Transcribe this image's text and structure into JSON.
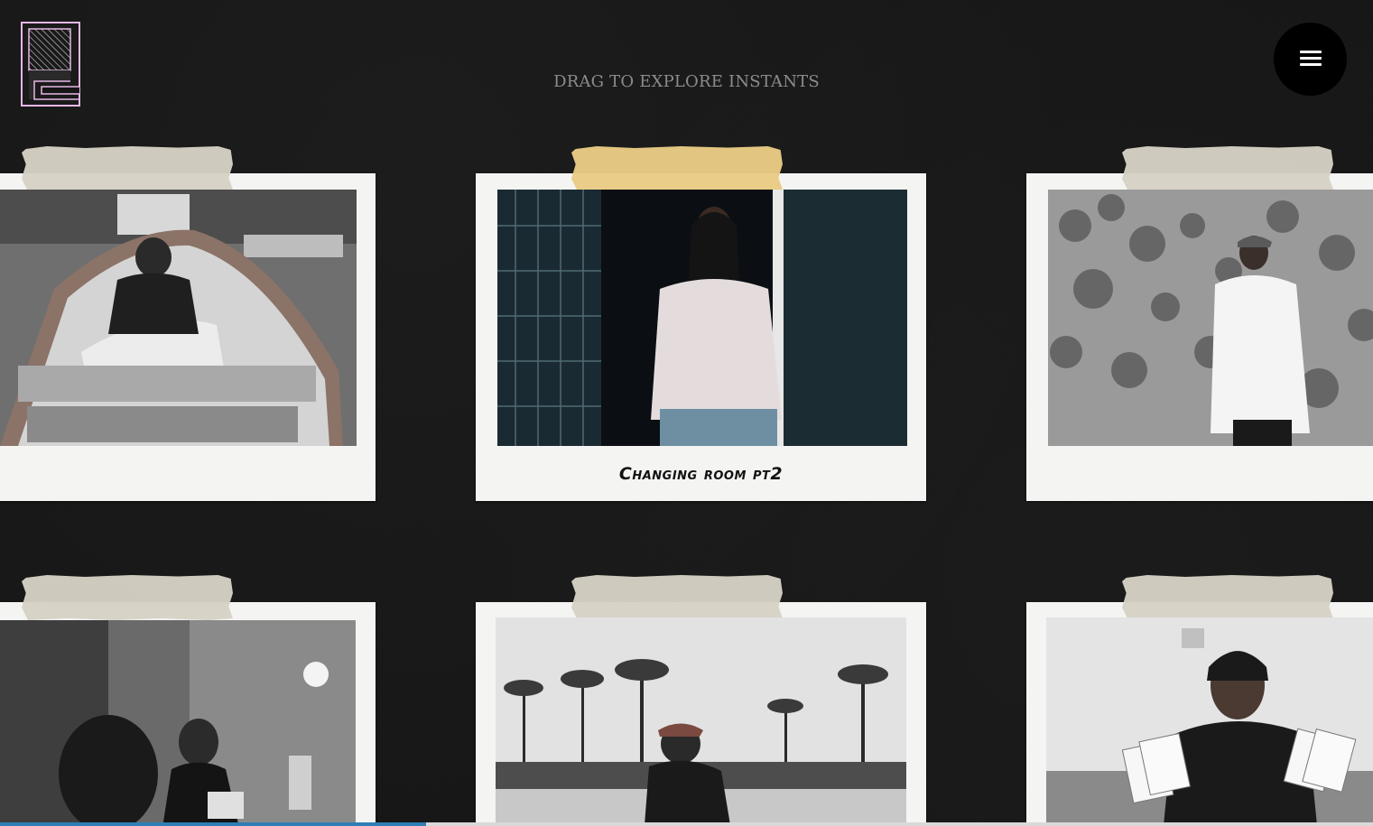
{
  "header": {
    "logo_icon": "pe-monogram-logo",
    "hint": "DRAG TO EXPLORE INSTANTS",
    "menu_icon": "hamburger-menu-icon"
  },
  "colors": {
    "background": "#161616",
    "polaroid_frame": "#f4f4f3",
    "tape": "#d6d1c5",
    "tape_highlight": "#e8cb84",
    "logo_stroke": "#e8b7e6",
    "menu_button": "#000000",
    "progress": "#2f7fb6"
  },
  "instants": [
    {
      "caption": "",
      "scene": "woman-in-boat"
    },
    {
      "caption": "Changing room pt2",
      "scene": "woman-in-changing-room"
    },
    {
      "caption": "",
      "scene": "woman-by-ivy-wall"
    },
    {
      "caption": "",
      "scene": "women-at-table"
    },
    {
      "caption": "",
      "scene": "man-with-palm-trees"
    },
    {
      "caption": "",
      "scene": "woman-holding-cards"
    }
  ],
  "scroll": {
    "progress": 0.31
  }
}
